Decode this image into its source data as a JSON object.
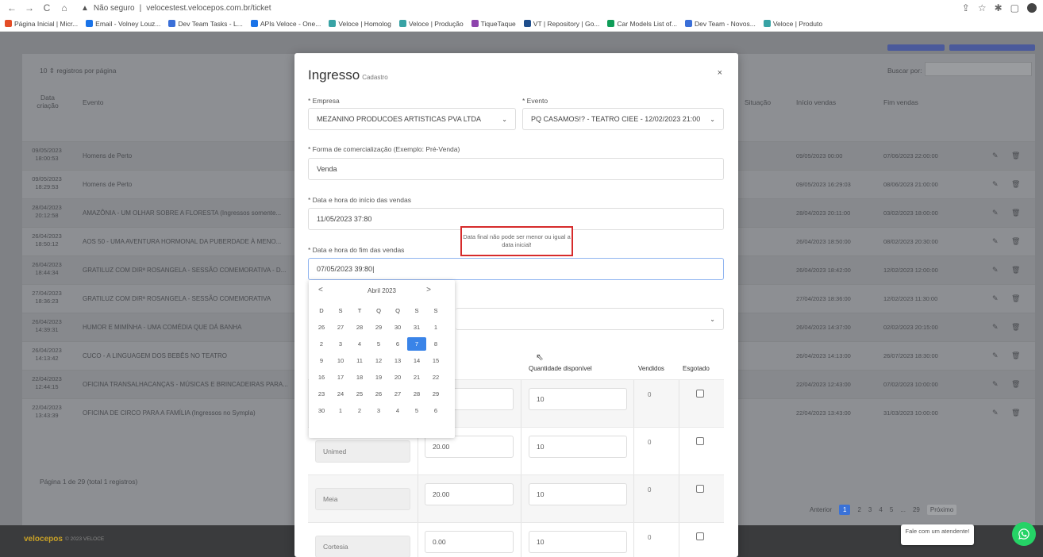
{
  "browser": {
    "back": "←",
    "forward": "→",
    "reload": "C",
    "home": "⌂",
    "security": "Não seguro",
    "url": "velocestest.velocepos.com.br/ticket",
    "bookmarks": [
      {
        "label": "Página Inicial | Micr...",
        "color": "#e44d26"
      },
      {
        "label": "Email - Volney Louz...",
        "color": "#1a73e8"
      },
      {
        "label": "Dev Team Tasks - L...",
        "color": "#3a6fd8"
      },
      {
        "label": "APIs Veloce - One...",
        "color": "#1a73e8"
      },
      {
        "label": "Veloce | Homolog",
        "color": "#38a3a5"
      },
      {
        "label": "Veloce | Produção",
        "color": "#38a3a5"
      },
      {
        "label": "TiqueTaque",
        "color": "#8e44ad"
      },
      {
        "label": "VT | Repository | Go...",
        "color": "#1f4e8c"
      },
      {
        "label": "Car Models List of...",
        "color": "#0f9d58"
      },
      {
        "label": "Dev Team - Novos...",
        "color": "#3a6fd8"
      },
      {
        "label": "Veloce | Produto",
        "color": "#38a3a5"
      }
    ]
  },
  "background": {
    "per_page": "10",
    "per_page_label": "registros por página",
    "search_label": "Buscar por:",
    "col_created": "Data criação",
    "col_event": "Evento",
    "col_situacao": "Situação",
    "col_start": "Início vendas",
    "col_end": "Fim vendas",
    "rows": [
      {
        "date": "09/05/2023 18:00:53",
        "event": "Homens de Perto",
        "start": "09/05/2023 00:00",
        "end": "07/06/2023 22:00:00"
      },
      {
        "date": "09/05/2023 18:29:53",
        "event": "Homens de Perto",
        "start": "09/05/2023 16:29:03",
        "end": "08/06/2023 21:00:00"
      },
      {
        "date": "28/04/2023 20:12:58",
        "event": "AMAZÔNIA - UM OLHAR SOBRE A FLORESTA (Ingressos somente...",
        "start": "28/04/2023 20:11:00",
        "end": "03/02/2023 18:00:00"
      },
      {
        "date": "26/04/2023 18:50:12",
        "event": "AOS 50 - UMA AVENTURA HORMONAL DA PUBERDADE À MENO...",
        "start": "26/04/2023 18:50:00",
        "end": "08/02/2023 20:30:00"
      },
      {
        "date": "26/04/2023 18:44:34",
        "event": "GRATILUZ COM DIRª ROSANGELA - SESSÃO COMEMORATIVA - D...",
        "start": "26/04/2023 18:42:00",
        "end": "12/02/2023 12:00:00"
      },
      {
        "date": "27/04/2023 18:36:23",
        "event": "GRATILUZ COM DIRª ROSANGELA - SESSÃO COMEMORATIVA",
        "start": "27/04/2023 18:36:00",
        "end": "12/02/2023 11:30:00"
      },
      {
        "date": "26/04/2023 14:39:31",
        "event": "HUMOR E MIMÍNHA - UMA COMÉDIA QUE DÁ BANHA",
        "start": "26/04/2023 14:37:00",
        "end": "02/02/2023 20:15:00"
      },
      {
        "date": "26/04/2023 14:13:42",
        "event": "CUCO - A LINGUAGEM DOS BEBÊS NO TEATRO",
        "start": "26/04/2023 14:13:00",
        "end": "26/07/2023 18:30:00"
      },
      {
        "date": "22/04/2023 12:44:15",
        "event": "OFICINA TRANSALHACANÇAS - MÚSICAS E BRINCADEIRAS PARA...",
        "start": "22/04/2023 12:43:00",
        "end": "07/02/2023 10:00:00"
      },
      {
        "date": "22/04/2023 13:43:39",
        "event": "OFICINA DE CIRCO PARA A FAMÍLIA (Ingressos no Sympla)",
        "start": "22/04/2023 13:43:00",
        "end": "31/03/2023 10:00:00"
      }
    ],
    "footer_text": "Página 1 de 29 (total 1 registros)",
    "pagination": {
      "prev": "Anterior",
      "pages": [
        "1",
        "2",
        "3",
        "4",
        "5",
        "...",
        "29"
      ],
      "next": "Próximo"
    },
    "footer_logo": "velocepos",
    "footer_sub": "© 2023 VELOCE"
  },
  "modal": {
    "title": "Ingresso",
    "subtitle": "Cadastro",
    "close": "×",
    "empresa_label": "* Empresa",
    "empresa_value": "MEZANINO PRODUCOES ARTISTICAS PVA LTDA",
    "evento_label": "* Evento",
    "evento_value": "PQ CASAMOS!? - TEATRO CIEE - 12/02/2023 21:00",
    "forma_label": "* Forma de comercialização (Exemplo: Pré-Venda)",
    "forma_value": "Venda",
    "inicio_label": "* Data e hora do início das vendas",
    "inicio_value": "11/05/2023 37:80",
    "fim_label": "* Data e hora do fim das vendas",
    "fim_value": "07/05/2023 39:80|",
    "error_text": "Data final não pode ser menor ou igual a data inicial!",
    "col_qtd": "Quantidade disponível",
    "col_vendidos": "Vendidos",
    "col_esgotado": "Esgotado",
    "rows": [
      {
        "name": "",
        "price": "",
        "qty": "10",
        "sold": "0"
      },
      {
        "name": "Unimed",
        "price": "20.00",
        "qty": "10",
        "sold": "0"
      },
      {
        "name": "Meia",
        "price": "20.00",
        "qty": "10",
        "sold": "0"
      },
      {
        "name": "Cortesia",
        "price": "0.00",
        "qty": "10",
        "sold": "0"
      }
    ]
  },
  "calendar": {
    "prev": "<",
    "next": ">",
    "month": "Abril 2023",
    "weekdays": [
      "D",
      "S",
      "T",
      "Q",
      "Q",
      "S",
      "S"
    ],
    "days": [
      "26",
      "27",
      "28",
      "29",
      "30",
      "31",
      "1",
      "2",
      "3",
      "4",
      "5",
      "6",
      "7",
      "8",
      "9",
      "10",
      "11",
      "12",
      "13",
      "14",
      "15",
      "16",
      "17",
      "18",
      "19",
      "20",
      "21",
      "22",
      "23",
      "24",
      "25",
      "26",
      "27",
      "28",
      "29",
      "30",
      "1",
      "2",
      "3",
      "4",
      "5",
      "6"
    ],
    "selected": "7"
  },
  "chat": {
    "text": "Fale com um atendente!"
  },
  "colors": {
    "accent": "#3a84e8",
    "error": "#d62b2b",
    "whatsapp": "#25d366"
  }
}
